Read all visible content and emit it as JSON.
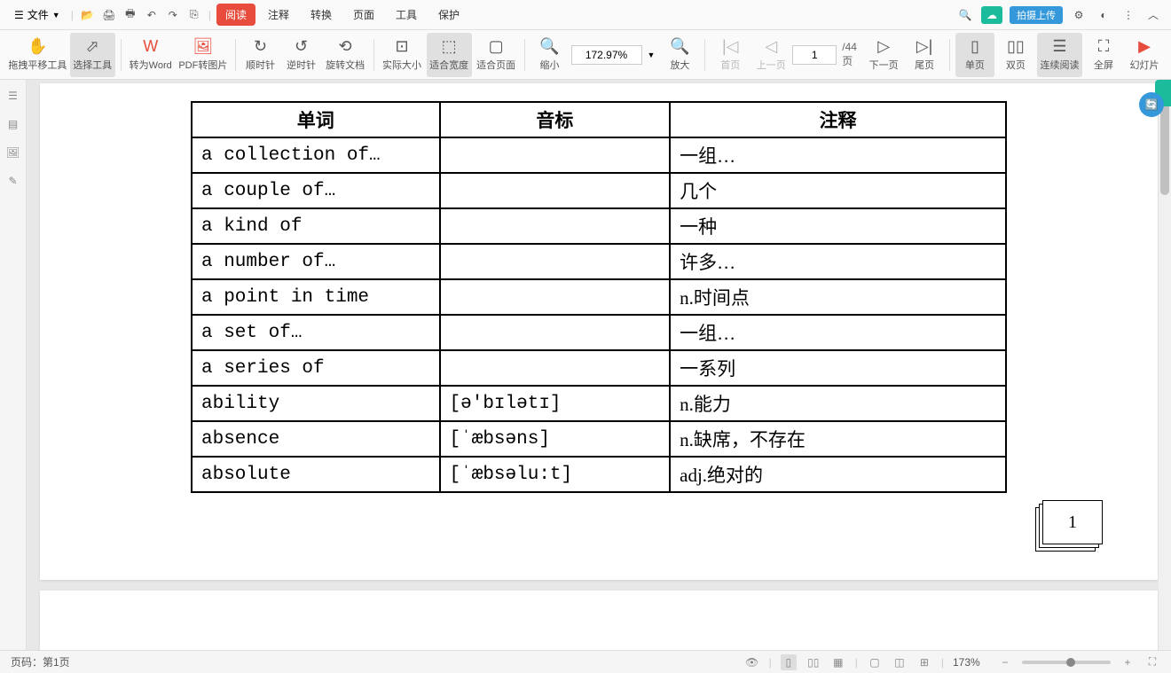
{
  "menubar": {
    "file_label": "文件",
    "tabs": [
      "阅读",
      "注释",
      "转换",
      "页面",
      "工具",
      "保护"
    ],
    "active_tab": 0,
    "upload_label": "拍摄上传",
    "search_placeholder": "搜索"
  },
  "toolbar": {
    "hand_tool": "拖拽平移工具",
    "select_tool": "选择工具",
    "to_word": "转为Word",
    "pdf_to_img": "PDF转图片",
    "rotate_cw": "顺时针",
    "rotate_ccw": "逆时针",
    "rotate_doc": "旋转文档",
    "actual_size": "实际大小",
    "fit_width": "适合宽度",
    "fit_page": "适合页面",
    "zoom_out": "缩小",
    "zoom_value": "172.97%",
    "zoom_in": "放大",
    "first_page": "首页",
    "prev_page": "上一页",
    "page_current": "1",
    "page_total": "/44页",
    "next_page": "下一页",
    "last_page": "尾页",
    "single_page": "单页",
    "double_page": "双页",
    "continuous": "连续阅读",
    "fullscreen": "全屏",
    "slideshow": "幻灯片"
  },
  "document": {
    "headers": [
      "单词",
      "音标",
      "注释"
    ],
    "rows": [
      {
        "word": "a collection of…",
        "phon": "",
        "def": "一组…"
      },
      {
        "word": "a couple of…",
        "phon": "",
        "def": "几个"
      },
      {
        "word": "a kind of",
        "phon": "",
        "def": "一种"
      },
      {
        "word": "a number of…",
        "phon": "",
        "def": "许多…"
      },
      {
        "word": "a point in time",
        "phon": "",
        "def": "n.时间点"
      },
      {
        "word": "a set of…",
        "phon": "",
        "def": "一组…"
      },
      {
        "word": "a series of",
        "phon": "",
        "def": "一系列"
      },
      {
        "word": "ability",
        "phon": "[ə'bɪlətɪ]",
        "def": "n.能力"
      },
      {
        "word": "absence",
        "phon": "[ˈæbsəns]",
        "def": "n.缺席，不存在"
      },
      {
        "word": "absolute",
        "phon": "[ˈæbsəlu:t]",
        "def": "adj.绝对的"
      }
    ],
    "page_number": "1"
  },
  "statusbar": {
    "page_label": "页码：第1页",
    "zoom_display": "173%"
  }
}
